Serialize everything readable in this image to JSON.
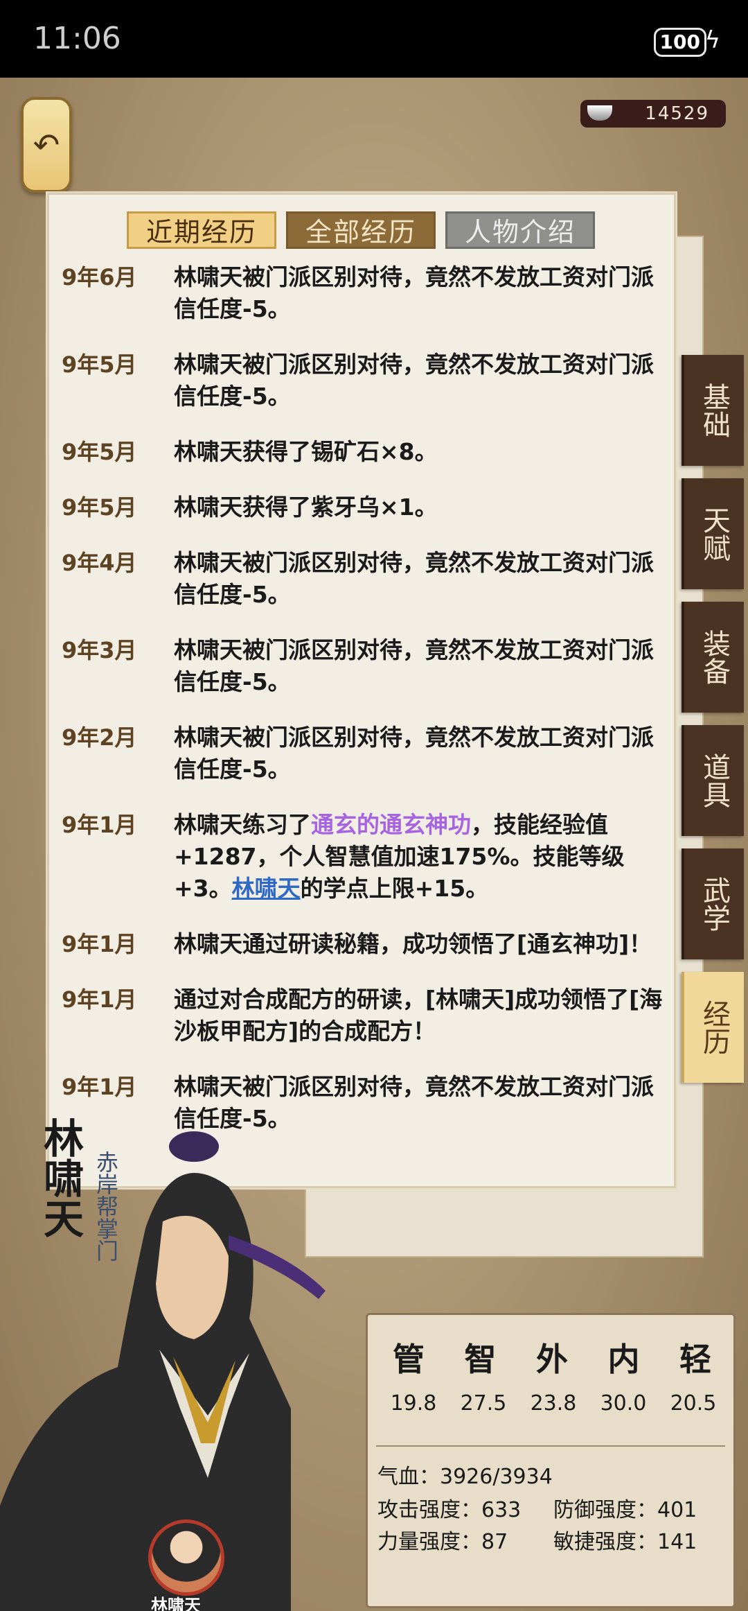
{
  "status": {
    "time": "11:06",
    "battery": "100"
  },
  "currency": {
    "amount": "14529",
    "icon": "silver-ingot-icon"
  },
  "tabs": [
    "近期经历",
    "全部经历",
    "人物介绍"
  ],
  "log": [
    {
      "date": "9年6月",
      "text": "林啸天被门派区别对待，竟然不发放工资对门派信任度-5。"
    },
    {
      "date": "9年5月",
      "text": "林啸天被门派区别对待，竟然不发放工资对门派信任度-5。"
    },
    {
      "date": "9年5月",
      "text": "林啸天获得了锡矿石×8。"
    },
    {
      "date": "9年5月",
      "text": "林啸天获得了紫牙乌×1。"
    },
    {
      "date": "9年4月",
      "text": "林啸天被门派区别对待，竟然不发放工资对门派信任度-5。"
    },
    {
      "date": "9年3月",
      "text": "林啸天被门派区别对待，竟然不发放工资对门派信任度-5。"
    },
    {
      "date": "9年2月",
      "text": "林啸天被门派区别对待，竟然不发放工资对门派信任度-5。"
    },
    {
      "date": "9年1月",
      "t1": "林啸天练习了",
      "skill": "通玄的通玄神功",
      "t2": "，技能经验值+1287，个人智慧值加速175%。技能等级+3。",
      "link": "林啸天",
      "t3": "的学点上限+15。"
    },
    {
      "date": "9年1月",
      "text": "林啸天通过研读秘籍，成功领悟了[通玄神功]！"
    },
    {
      "date": "9年1月",
      "text": "通过对合成配方的研读，[林啸天]成功领悟了[海沙板甲配方]的合成配方！"
    },
    {
      "date": "9年1月",
      "text": "林啸天被门派区别对待，竟然不发放工资对门派信任度-5。"
    }
  ],
  "side_tabs": [
    "基础",
    "天赋",
    "装备",
    "道具",
    "武学",
    "经历"
  ],
  "hero": {
    "name": "林啸天",
    "title": "赤岸帮掌门",
    "avatar_name": "林啸天"
  },
  "stats": {
    "heads": [
      "管",
      "智",
      "外",
      "内",
      "轻"
    ],
    "values": [
      "19.8",
      "27.5",
      "23.8",
      "30.0",
      "20.5"
    ],
    "hp_label": "气血：",
    "hp": "3926/3934",
    "atk_label": "攻击强度：",
    "atk": "633",
    "def_label": "防御强度：",
    "def": "401",
    "str_label": "力量强度：",
    "str": "87",
    "agi_label": "敏捷强度：",
    "agi": "141"
  },
  "colors": {
    "skill_highlight": "#a664e0",
    "link": "#2f69c8",
    "active_tab": "#f1cf84"
  }
}
